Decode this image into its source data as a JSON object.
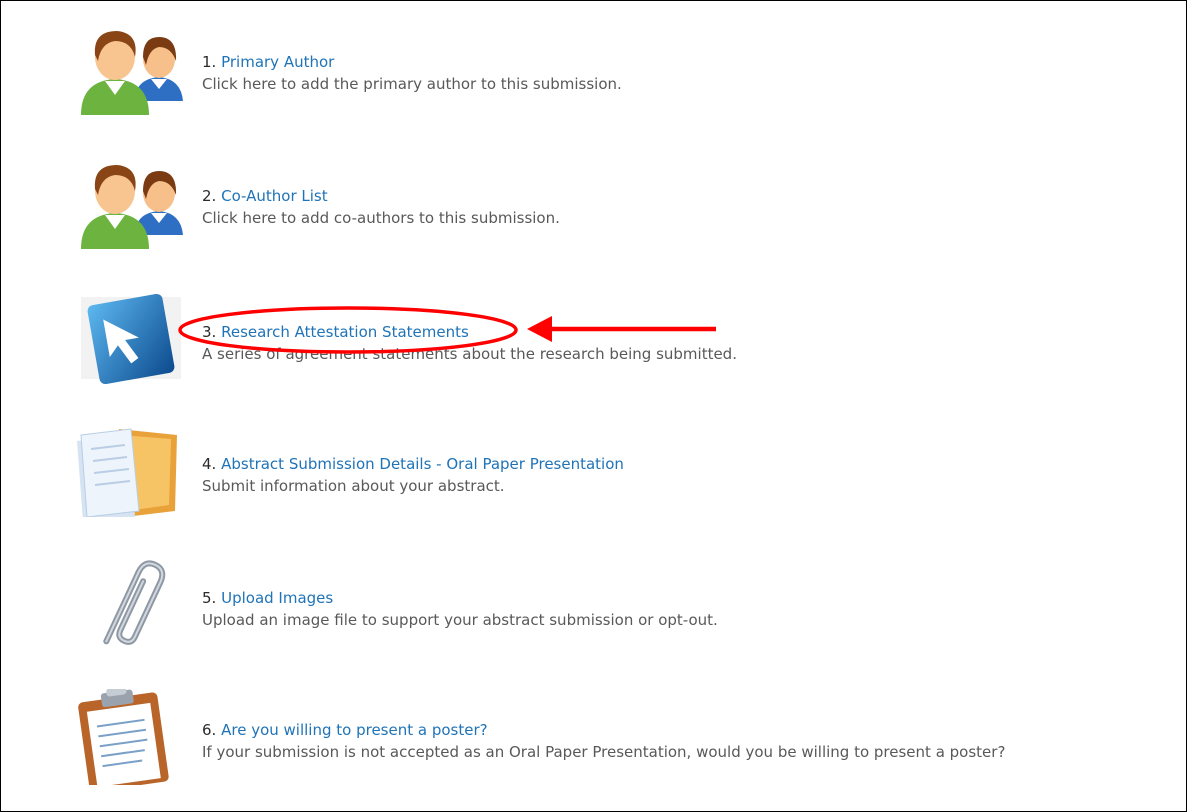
{
  "steps": [
    {
      "number": "1.",
      "title": "Primary Author",
      "description": "Click here to add the primary author to this submission.",
      "icon": "people-icon"
    },
    {
      "number": "2.",
      "title": "Co-Author List",
      "description": "Click here to add co-authors to this submission.",
      "icon": "people-icon"
    },
    {
      "number": "3.",
      "title": "Research Attestation Statements",
      "description": "A series of agreement statements about the research being submitted.",
      "icon": "cursor-arrow-icon"
    },
    {
      "number": "4.",
      "title": "Abstract Submission Details - Oral Paper Presentation",
      "description": "Submit information about your abstract.",
      "icon": "documents-folder-icon"
    },
    {
      "number": "5.",
      "title": "Upload Images",
      "description": "Upload an image file to support your abstract submission or opt-out.",
      "icon": "paperclip-icon"
    },
    {
      "number": "6.",
      "title": "Are you willing to present a poster?",
      "description": "If your submission is not accepted as an Oral Paper Presentation, would you be willing to present a poster?",
      "icon": "clipboard-icon"
    }
  ],
  "colors": {
    "link": "#1f73b7",
    "description": "#595959",
    "annotation": "#ff0000"
  }
}
